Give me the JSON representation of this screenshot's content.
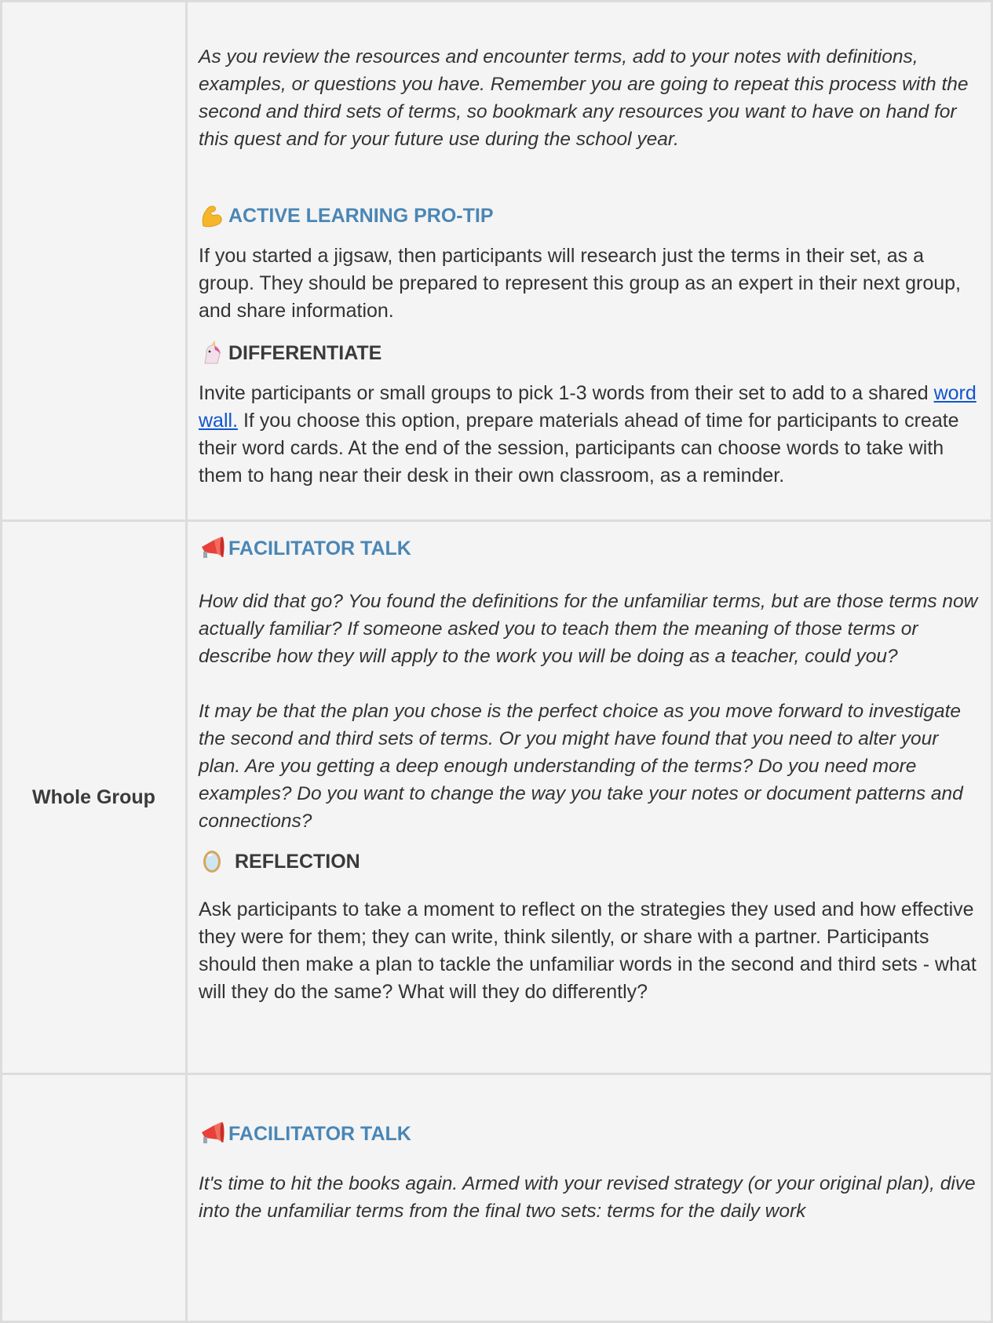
{
  "row1": {
    "left_label": "",
    "italic_para": "As you review the resources and encounter terms, add to your notes with definitions, examples, or questions you have. Remember you are going to repeat this process with the second and third sets of terms, so bookmark any resources you want to have on hand for this quest and for your future use during the school year.",
    "pro_tip": {
      "icon": "flexed-biceps-icon",
      "title": "ACTIVE LEARNING PRO-TIP",
      "text": "If you started a jigsaw, then participants will research just the terms in their set, as a group. They should be prepared to represent this group as an expert in their next group, and share information."
    },
    "differentiate": {
      "icon": "unicorn-icon",
      "title": "DIFFERENTIATE",
      "text_before": "Invite participants or small groups to pick 1-3 words from their set to add to a shared ",
      "link": "word wall.",
      "text_after": " If you choose this option, prepare materials ahead of time for participants to create their word cards. At the end of the session, participants can choose words to take with them to hang near their desk in their own classroom, as a reminder."
    }
  },
  "row2": {
    "left_label": "Whole Group",
    "facilitator": {
      "icon": "megaphone-icon",
      "title": "FACILITATOR TALK",
      "para1": "How did that go? You found the definitions for the unfamiliar terms, but are those terms now actually familiar? If someone asked you to teach them the meaning of those terms or describe how they will apply to the work you will be doing as a teacher, could you?",
      "para2": "It may be that the plan you chose is the perfect choice as you move forward to investigate the second and third sets of terms. Or you might have found that you need to alter your plan. Are you getting a deep enough understanding of the terms? Do you need more examples? Do you want to change the way you take your notes or document patterns and connections?"
    },
    "reflection": {
      "icon": "mirror-icon",
      "title": "REFLECTION",
      "text": "Ask participants to take a moment to reflect on the strategies they used and how effective they were for them; they can write, think silently, or share with a partner. Participants should then make a plan to tackle the unfamiliar words in the second and third sets - what will they do the same? What will they do differently?"
    }
  },
  "row3": {
    "left_label": "",
    "facilitator": {
      "icon": "megaphone-icon",
      "title": "FACILITATOR TALK",
      "para1": "It's time to hit the books again. Armed with your revised strategy (or your original plan), dive into the unfamiliar terms from the final two sets: terms for the daily work"
    }
  }
}
